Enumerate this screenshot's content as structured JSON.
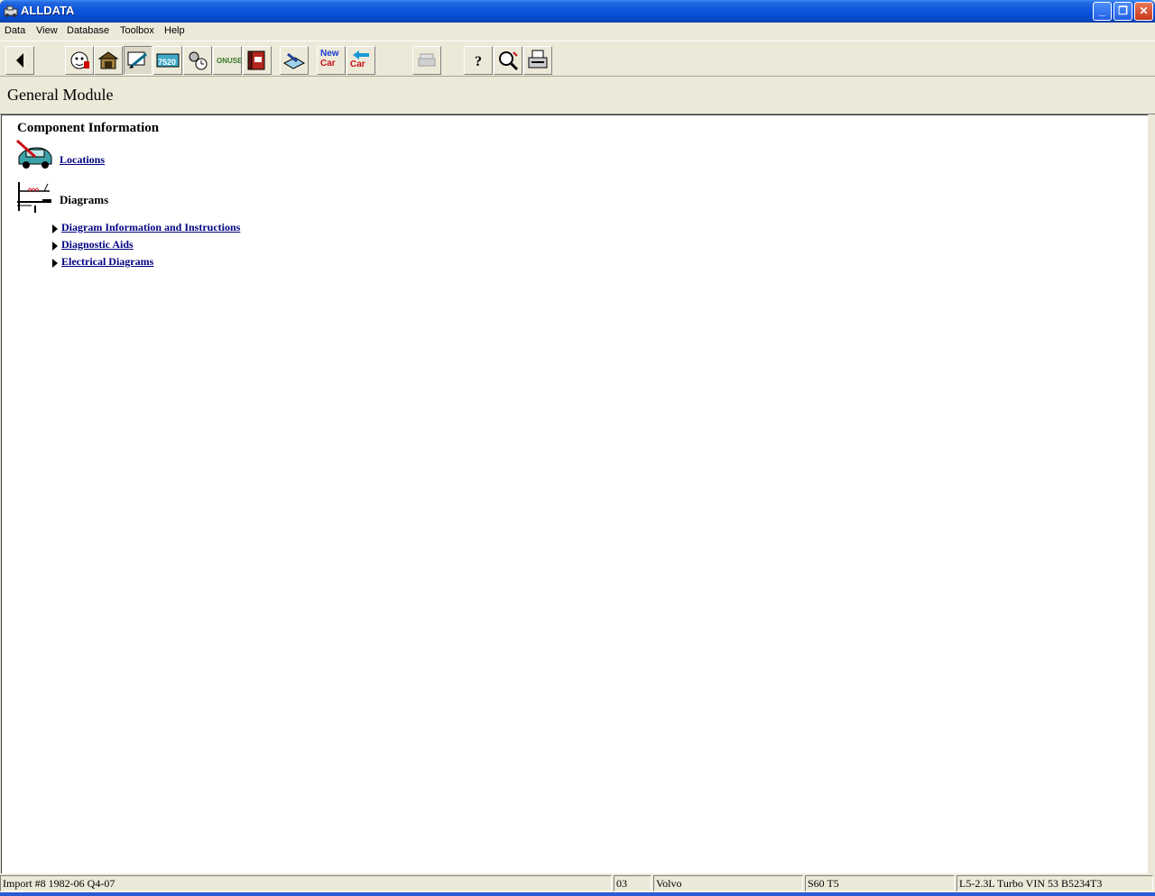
{
  "window": {
    "title": "ALLDATA",
    "minimize_label": "_",
    "restore_label": "❐",
    "close_label": "✕"
  },
  "menu": [
    "Data",
    "View",
    "Database",
    "Toolbox",
    "Help"
  ],
  "toolbar": {
    "back_label": "",
    "counter_label": "7520",
    "onuse_label": "ONUSE",
    "new_car_label": [
      "New",
      "Car"
    ],
    "car_label": "Car"
  },
  "header": {
    "title": "General Module"
  },
  "content": {
    "section_title": "Component Information",
    "locations_label": "Locations",
    "diagrams_label": "Diagrams",
    "diagram_links": [
      "Diagram Information and Instructions",
      "Diagnostic Aids",
      "Electrical Diagrams"
    ]
  },
  "statusbar": {
    "database": "Import #8 1982-06 Q4-07",
    "year": "03",
    "make": "Volvo",
    "model": "S60 T5",
    "engine": "L5-2.3L Turbo VIN 53 B5234T3"
  },
  "colors": {
    "titlebar": "#0a55dd",
    "link": "#000080",
    "chrome": "#ece9d8"
  }
}
